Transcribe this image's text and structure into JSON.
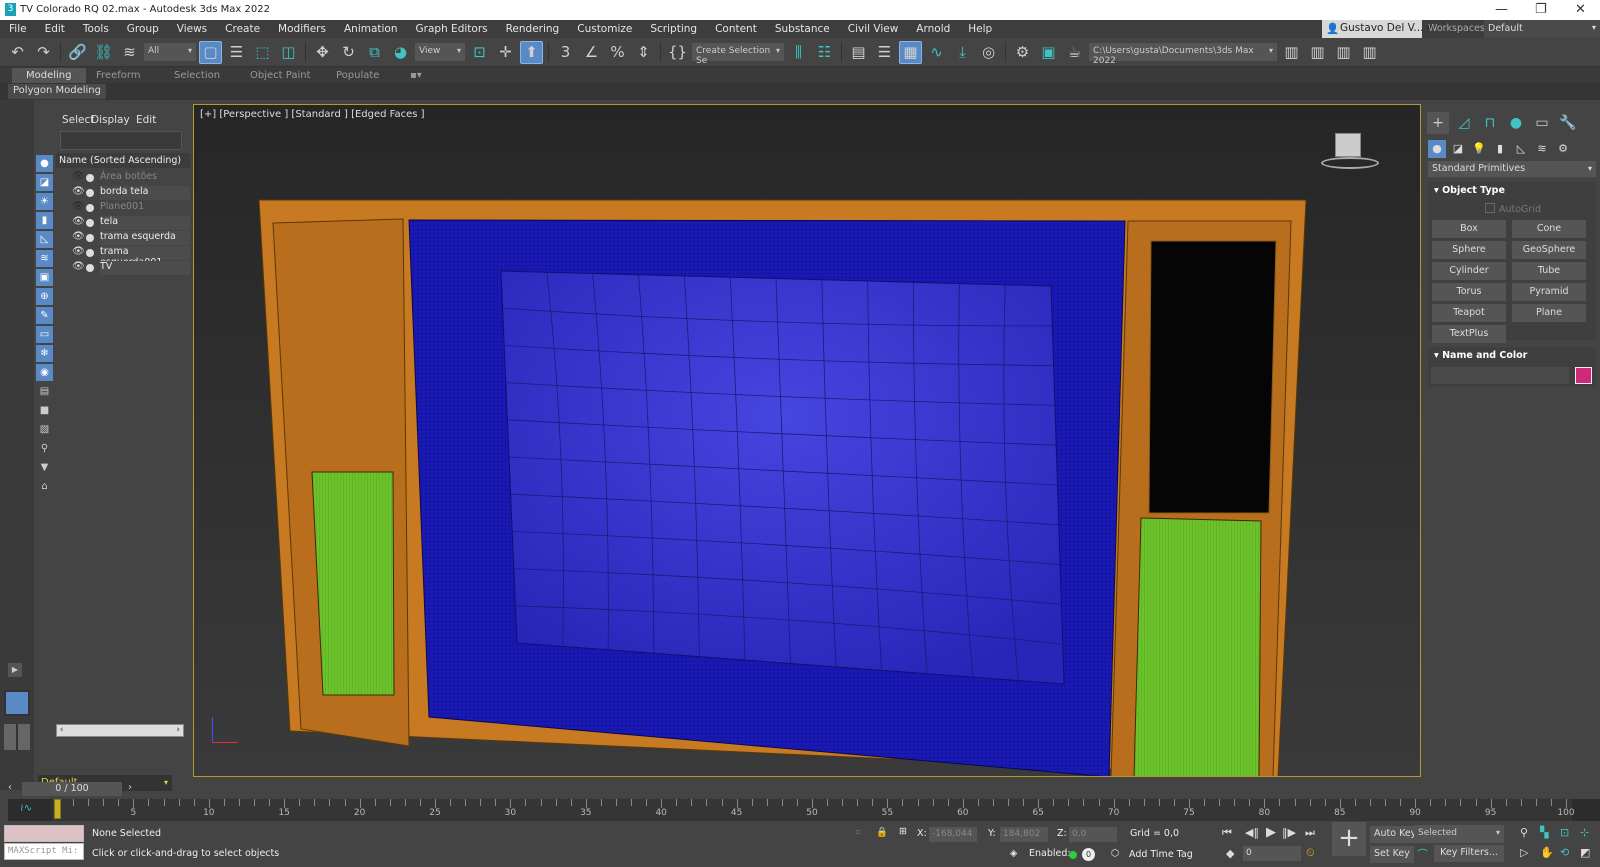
{
  "titlebar": {
    "title": "TV Colorado RQ 02.max - Autodesk 3ds Max 2022",
    "app_icon": "3",
    "controls": [
      "minimize-icon",
      "restore-icon",
      "close-icon"
    ]
  },
  "menu": {
    "items": [
      "File",
      "Edit",
      "Tools",
      "Group",
      "Views",
      "Create",
      "Modifiers",
      "Animation",
      "Graph Editors",
      "Rendering",
      "Customize",
      "Scripting",
      "Content",
      "Substance",
      "Civil View",
      "Arnold",
      "Help"
    ],
    "user": "Gustavo Del V...",
    "workspaces_label": "Workspaces:",
    "workspace": "Default"
  },
  "toolbar": {
    "filter": "All",
    "refcoord": "View",
    "selection_set": "Create Selection Se",
    "project_path": "C:\\Users\\gusta\\Documents\\3ds Max 2022"
  },
  "ribbon": {
    "tabs": [
      "Modeling",
      "Freeform",
      "Selection",
      "Object Paint",
      "Populate"
    ],
    "active": "Modeling",
    "panel": "Polygon Modeling"
  },
  "explorer": {
    "menus": [
      "Select",
      "Display",
      "Edit"
    ],
    "header": "Name (Sorted Ascending)",
    "rows": [
      {
        "name": "Área botões",
        "visible": false
      },
      {
        "name": "borda tela",
        "visible": true
      },
      {
        "name": "Plane001",
        "visible": false
      },
      {
        "name": "tela",
        "visible": true
      },
      {
        "name": "trama esquerda",
        "visible": true
      },
      {
        "name": "trama esquerda001",
        "visible": true
      },
      {
        "name": "TV",
        "visible": true
      }
    ],
    "layer": "Default"
  },
  "viewport": {
    "label": "[+] [Perspective ] [Standard ] [Edged Faces ]"
  },
  "command_panel": {
    "category": "Standard Primitives",
    "object_type": "Object Type",
    "autogrid": "AutoGrid",
    "buttons": [
      "Box",
      "Cone",
      "Sphere",
      "GeoSphere",
      "Cylinder",
      "Tube",
      "Torus",
      "Pyramid",
      "Teapot",
      "Plane",
      "TextPlus"
    ],
    "name_and_color": "Name and Color",
    "object_color": "#d0287a"
  },
  "timeline": {
    "frame": "0 / 100",
    "ticks": [
      0,
      5,
      10,
      15,
      20,
      25,
      30,
      35,
      40,
      45,
      50,
      55,
      60,
      65,
      70,
      75,
      80,
      85,
      90,
      95,
      100
    ]
  },
  "status": {
    "maxscript": "MAXScript Mi:",
    "selection": "None Selected",
    "prompt": "Click or click-and-drag to select objects",
    "x_label": "X:",
    "x": "-168,044",
    "y_label": "Y:",
    "y": "184,802",
    "z_label": "Z:",
    "z": "0,0",
    "grid": "Grid = 0,0",
    "enabled_label": "Enabled:",
    "add_time_tag": "Add Time Tag",
    "current_frame": "0",
    "auto_key": "Auto Key",
    "set_key": "Set Key",
    "key_mode": "Selected",
    "key_filters": "Key Filters..."
  }
}
